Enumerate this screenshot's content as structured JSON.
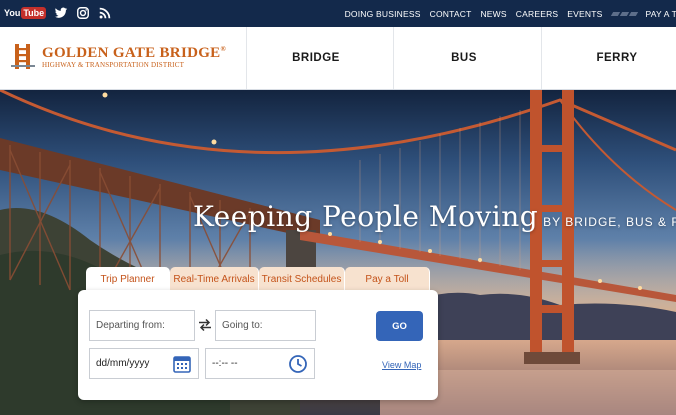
{
  "topbar": {
    "social": [
      {
        "icon": "youtube-icon",
        "label_a": "You",
        "label_b": "Tube"
      },
      {
        "icon": "twitter-icon"
      },
      {
        "icon": "instagram-icon"
      },
      {
        "icon": "rss-icon"
      }
    ],
    "links": [
      "DOING BUSINESS",
      "CONTACT",
      "NEWS",
      "CAREERS",
      "EVENTS"
    ],
    "pay_label": "PAY A T"
  },
  "header": {
    "logo_title": "GOLDEN GATE BRIDGE",
    "logo_reg": "®",
    "logo_subtitle": "HIGHWAY & TRANSPORTATION DISTRICT",
    "nav": [
      "BRIDGE",
      "BUS",
      "FERRY"
    ]
  },
  "hero": {
    "tagline_main": "Keeping People Moving",
    "tagline_sub": "BY BRIDGE, BUS & FERRY"
  },
  "planner": {
    "tabs": [
      "Trip Planner",
      "Real-Time Arrivals",
      "Transit Schedules",
      "Pay a Toll"
    ],
    "active_tab": "Trip Planner",
    "from_placeholder": "Departing from:",
    "to_placeholder": "Going to:",
    "date_value": "dd/mm/yyyy",
    "time_value": "--:-- --",
    "go_label": "GO",
    "view_map_label": "View Map"
  },
  "colors": {
    "topbar": "#13294b",
    "brand_orange": "#c8611b",
    "accent_blue": "#3465b8",
    "tab_text": "#c4531a",
    "tab_bg": "#f7e2cf"
  }
}
